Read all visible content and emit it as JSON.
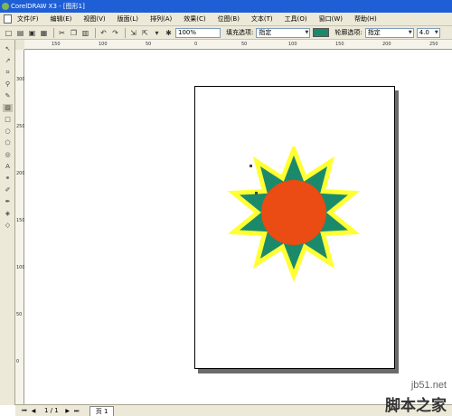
{
  "window": {
    "title": "CorelDRAW X3 - [图形1]"
  },
  "menu": [
    "文件(F)",
    "编辑(E)",
    "视图(V)",
    "版面(L)",
    "排列(A)",
    "效果(C)",
    "位图(B)",
    "文本(T)",
    "工具(O)",
    "窗口(W)",
    "帮助(H)"
  ],
  "toolbar": {
    "zoom_value": "100%",
    "fill_label": "填充选项:",
    "fill_value": "指定",
    "fill_color": "#1b8a6b",
    "outline_label": "轮廓选项:",
    "outline_value": "指定",
    "outline_width": "4.0"
  },
  "ruler_top_labels": [
    "150",
    "100",
    "50",
    "0",
    "50",
    "100",
    "150",
    "200",
    "250"
  ],
  "ruler_left_labels": [
    "300",
    "250",
    "200",
    "150",
    "100",
    "50",
    "0"
  ],
  "status": {
    "page_indicator": "1 / 1",
    "page_tab": "页 1"
  },
  "colors": {
    "star_outline": "#ffff33",
    "star_fill": "#1b8a6b",
    "circle": "#ea4c13"
  },
  "watermark": {
    "url": "jb51.net",
    "brand": "脚本之家"
  }
}
